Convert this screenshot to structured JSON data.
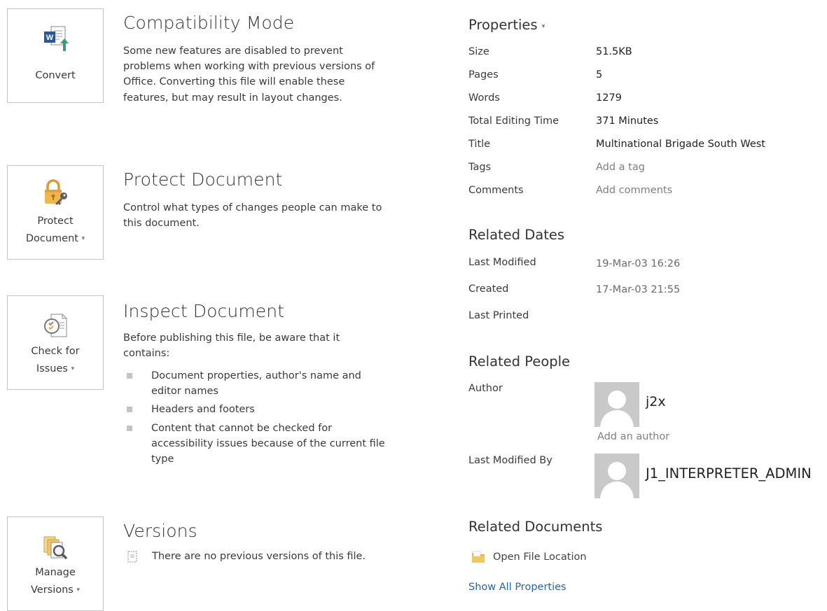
{
  "sections": {
    "compat": {
      "button_label": "Convert",
      "title": "Compatibility Mode",
      "text": "Some new features are disabled to prevent problems when working with previous versions of Office. Converting this file will enable these features, but may result in layout changes.",
      "icon": "word-convert-icon"
    },
    "protect": {
      "button_line1": "Protect",
      "button_line2": "Document",
      "title": "Protect Document",
      "text": "Control what types of changes people can make to this document.",
      "icon": "lock-key-icon"
    },
    "inspect": {
      "button_line1": "Check for",
      "button_line2": "Issues",
      "title": "Inspect Document",
      "text": "Before publishing this file, be aware that it contains:",
      "bullets": [
        "Document properties, author's name and editor names",
        "Headers and footers",
        "Content that cannot be checked for accessibility issues because of the current file type"
      ],
      "icon": "inspect-document-icon"
    },
    "versions": {
      "button_line1": "Manage",
      "button_line2": "Versions",
      "title": "Versions",
      "text": "There are no previous versions of this file.",
      "icon": "manage-versions-icon"
    }
  },
  "properties": {
    "heading": "Properties",
    "rows": [
      {
        "label": "Size",
        "value": "51.5KB"
      },
      {
        "label": "Pages",
        "value": "5"
      },
      {
        "label": "Words",
        "value": "1279"
      },
      {
        "label": "Total Editing Time",
        "value": "371 Minutes"
      },
      {
        "label": "Title",
        "value": "Multinational Brigade South West"
      },
      {
        "label": "Tags",
        "value": "Add a tag"
      },
      {
        "label": "Comments",
        "value": "Add comments"
      }
    ]
  },
  "related_dates": {
    "heading": "Related Dates",
    "rows": [
      {
        "label": "Last Modified",
        "value": "19-Mar-03 16:26"
      },
      {
        "label": "Created",
        "value": "17-Mar-03 21:55"
      },
      {
        "label": "Last Printed",
        "value": ""
      }
    ]
  },
  "related_people": {
    "heading": "Related People",
    "author_label": "Author",
    "author_name": "j2x",
    "add_author": "Add an author",
    "last_modified_label": "Last Modified By",
    "last_modified_name": "J1_INTERPRETER_ADMIN"
  },
  "related_documents": {
    "heading": "Related Documents",
    "open_location": "Open File Location",
    "show_all": "Show All Properties"
  },
  "dropdown_glyph": "▾",
  "colors": {
    "accent_link": "#2a64a6",
    "word_blue": "#2b579a",
    "lock_gold": "#e8a33a",
    "border": "#c6c6c6"
  }
}
